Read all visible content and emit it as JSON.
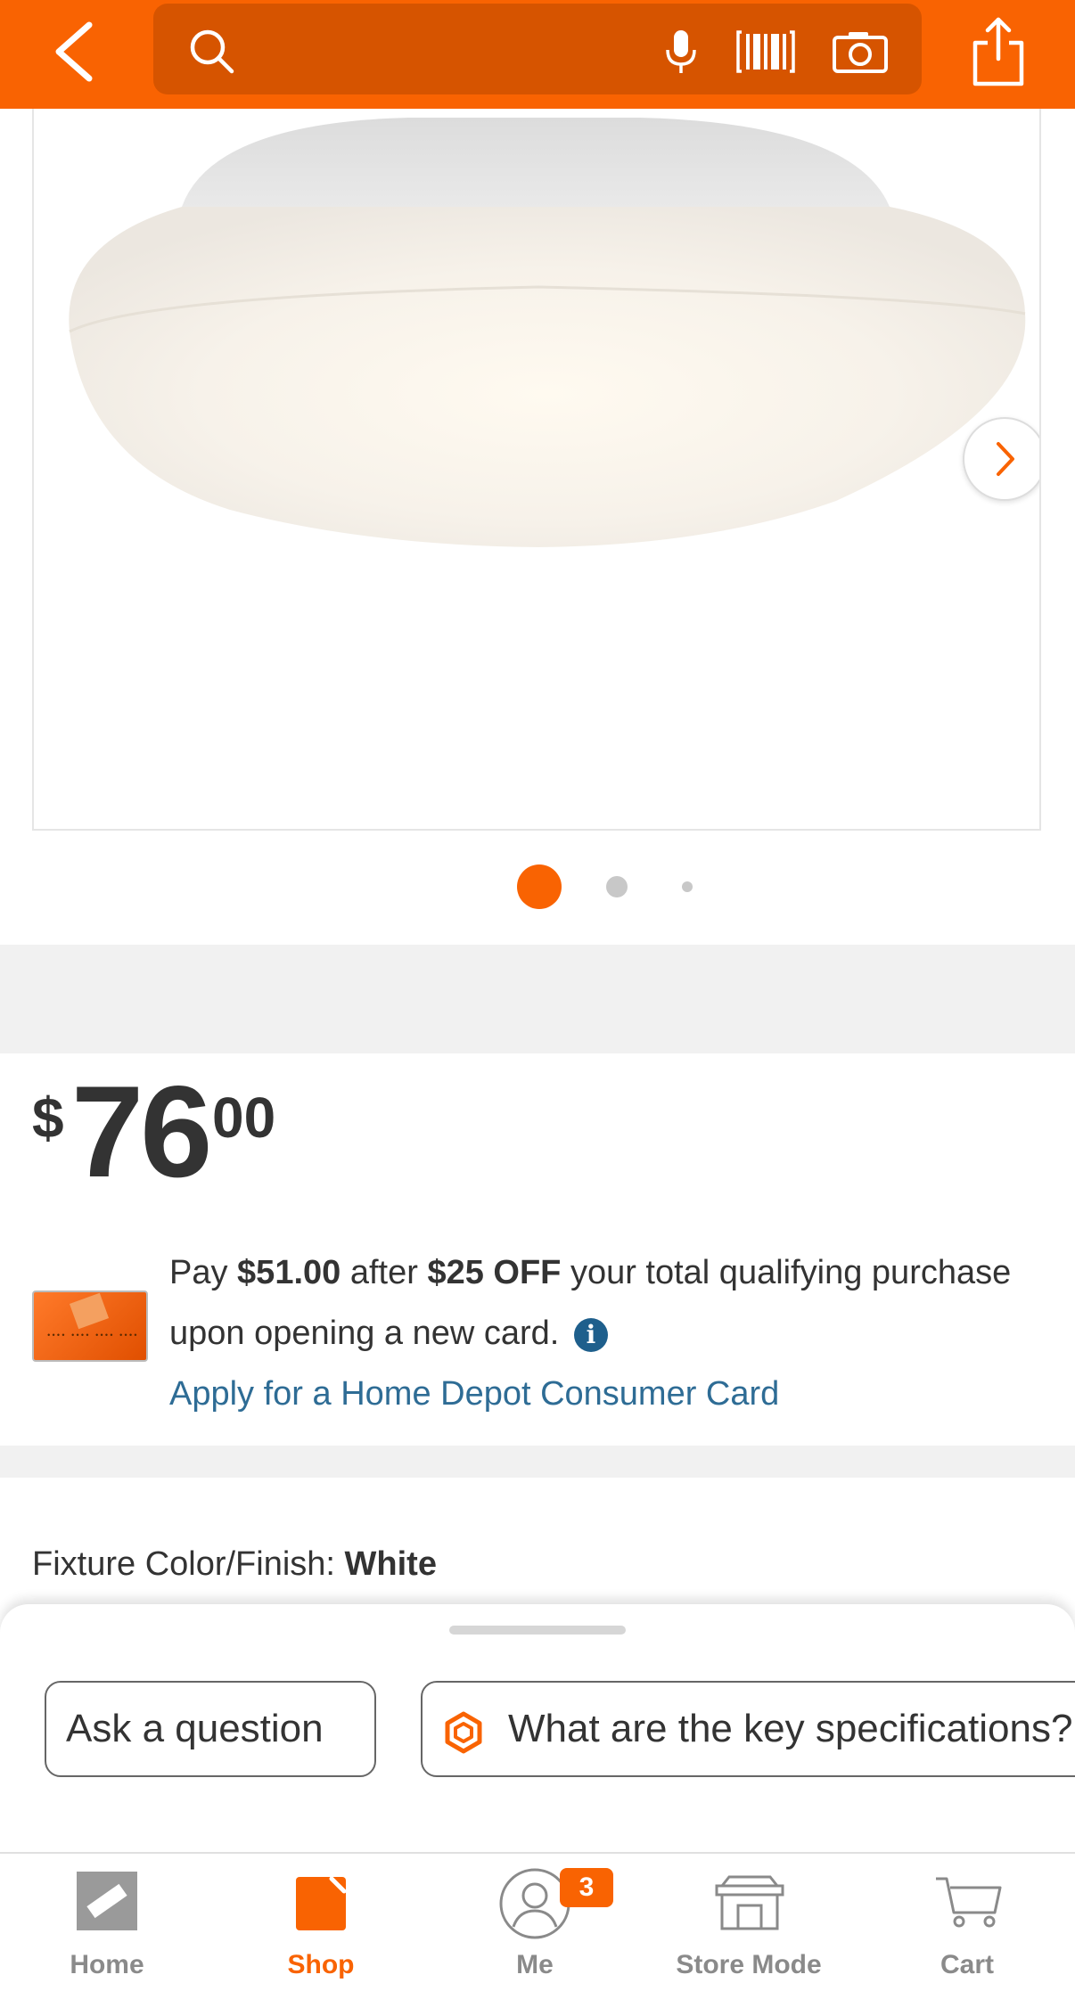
{
  "header": {
    "search_placeholder": "",
    "search_value": ""
  },
  "product": {
    "image_alt": "",
    "carousel": {
      "total": 3,
      "active": 1
    },
    "price": {
      "currency": "$",
      "whole": "76",
      "cents": "00"
    },
    "promo": {
      "pay": "Pay ",
      "discounted_price": "$51.00",
      "after": " after ",
      "discount": "$25 OFF",
      "rest": " your total qualifying purchase upon opening a new card.",
      "apply_link": "Apply for a Home Depot Consumer Card",
      "info_glyph": "i"
    },
    "fixture": {
      "label": "Fixture Color/Finish: ",
      "value": "White"
    }
  },
  "sheet": {
    "chips": [
      {
        "label": "Ask a question"
      },
      {
        "label": "What are the key specifications?"
      }
    ]
  },
  "nav": {
    "items": [
      {
        "label": "Home",
        "icon": "home-depot-logo-icon",
        "active": false
      },
      {
        "label": "Shop",
        "icon": "shop-bag-icon",
        "active": true
      },
      {
        "label": "Me",
        "icon": "user-icon",
        "active": false,
        "badge": "3"
      },
      {
        "label": "Store Mode",
        "icon": "store-icon",
        "active": false
      },
      {
        "label": "Cart",
        "icon": "cart-icon",
        "active": false
      }
    ]
  },
  "colors": {
    "brand_orange": "#f96302",
    "search_bg": "#d65400",
    "link_blue": "#2e6c95",
    "text": "#333333"
  }
}
